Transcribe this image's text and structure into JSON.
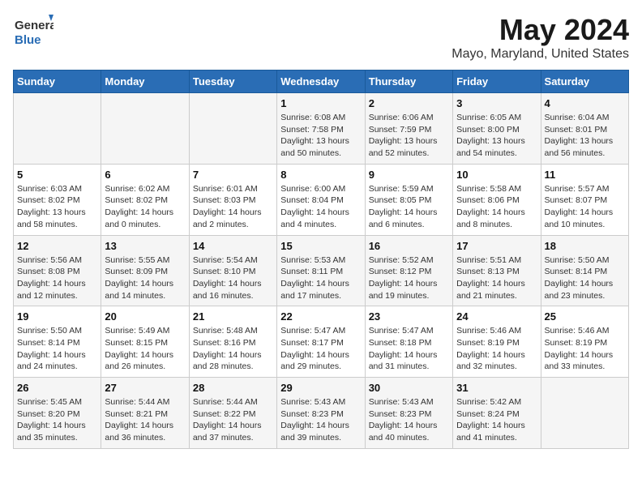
{
  "logo": {
    "text_general": "General",
    "text_blue": "Blue"
  },
  "title": "May 2024",
  "subtitle": "Mayo, Maryland, United States",
  "days_of_week": [
    "Sunday",
    "Monday",
    "Tuesday",
    "Wednesday",
    "Thursday",
    "Friday",
    "Saturday"
  ],
  "weeks": [
    [
      {
        "day": "",
        "sunrise": "",
        "sunset": "",
        "daylight": ""
      },
      {
        "day": "",
        "sunrise": "",
        "sunset": "",
        "daylight": ""
      },
      {
        "day": "",
        "sunrise": "",
        "sunset": "",
        "daylight": ""
      },
      {
        "day": "1",
        "sunrise": "Sunrise: 6:08 AM",
        "sunset": "Sunset: 7:58 PM",
        "daylight": "Daylight: 13 hours and 50 minutes."
      },
      {
        "day": "2",
        "sunrise": "Sunrise: 6:06 AM",
        "sunset": "Sunset: 7:59 PM",
        "daylight": "Daylight: 13 hours and 52 minutes."
      },
      {
        "day": "3",
        "sunrise": "Sunrise: 6:05 AM",
        "sunset": "Sunset: 8:00 PM",
        "daylight": "Daylight: 13 hours and 54 minutes."
      },
      {
        "day": "4",
        "sunrise": "Sunrise: 6:04 AM",
        "sunset": "Sunset: 8:01 PM",
        "daylight": "Daylight: 13 hours and 56 minutes."
      }
    ],
    [
      {
        "day": "5",
        "sunrise": "Sunrise: 6:03 AM",
        "sunset": "Sunset: 8:02 PM",
        "daylight": "Daylight: 13 hours and 58 minutes."
      },
      {
        "day": "6",
        "sunrise": "Sunrise: 6:02 AM",
        "sunset": "Sunset: 8:02 PM",
        "daylight": "Daylight: 14 hours and 0 minutes."
      },
      {
        "day": "7",
        "sunrise": "Sunrise: 6:01 AM",
        "sunset": "Sunset: 8:03 PM",
        "daylight": "Daylight: 14 hours and 2 minutes."
      },
      {
        "day": "8",
        "sunrise": "Sunrise: 6:00 AM",
        "sunset": "Sunset: 8:04 PM",
        "daylight": "Daylight: 14 hours and 4 minutes."
      },
      {
        "day": "9",
        "sunrise": "Sunrise: 5:59 AM",
        "sunset": "Sunset: 8:05 PM",
        "daylight": "Daylight: 14 hours and 6 minutes."
      },
      {
        "day": "10",
        "sunrise": "Sunrise: 5:58 AM",
        "sunset": "Sunset: 8:06 PM",
        "daylight": "Daylight: 14 hours and 8 minutes."
      },
      {
        "day": "11",
        "sunrise": "Sunrise: 5:57 AM",
        "sunset": "Sunset: 8:07 PM",
        "daylight": "Daylight: 14 hours and 10 minutes."
      }
    ],
    [
      {
        "day": "12",
        "sunrise": "Sunrise: 5:56 AM",
        "sunset": "Sunset: 8:08 PM",
        "daylight": "Daylight: 14 hours and 12 minutes."
      },
      {
        "day": "13",
        "sunrise": "Sunrise: 5:55 AM",
        "sunset": "Sunset: 8:09 PM",
        "daylight": "Daylight: 14 hours and 14 minutes."
      },
      {
        "day": "14",
        "sunrise": "Sunrise: 5:54 AM",
        "sunset": "Sunset: 8:10 PM",
        "daylight": "Daylight: 14 hours and 16 minutes."
      },
      {
        "day": "15",
        "sunrise": "Sunrise: 5:53 AM",
        "sunset": "Sunset: 8:11 PM",
        "daylight": "Daylight: 14 hours and 17 minutes."
      },
      {
        "day": "16",
        "sunrise": "Sunrise: 5:52 AM",
        "sunset": "Sunset: 8:12 PM",
        "daylight": "Daylight: 14 hours and 19 minutes."
      },
      {
        "day": "17",
        "sunrise": "Sunrise: 5:51 AM",
        "sunset": "Sunset: 8:13 PM",
        "daylight": "Daylight: 14 hours and 21 minutes."
      },
      {
        "day": "18",
        "sunrise": "Sunrise: 5:50 AM",
        "sunset": "Sunset: 8:14 PM",
        "daylight": "Daylight: 14 hours and 23 minutes."
      }
    ],
    [
      {
        "day": "19",
        "sunrise": "Sunrise: 5:50 AM",
        "sunset": "Sunset: 8:14 PM",
        "daylight": "Daylight: 14 hours and 24 minutes."
      },
      {
        "day": "20",
        "sunrise": "Sunrise: 5:49 AM",
        "sunset": "Sunset: 8:15 PM",
        "daylight": "Daylight: 14 hours and 26 minutes."
      },
      {
        "day": "21",
        "sunrise": "Sunrise: 5:48 AM",
        "sunset": "Sunset: 8:16 PM",
        "daylight": "Daylight: 14 hours and 28 minutes."
      },
      {
        "day": "22",
        "sunrise": "Sunrise: 5:47 AM",
        "sunset": "Sunset: 8:17 PM",
        "daylight": "Daylight: 14 hours and 29 minutes."
      },
      {
        "day": "23",
        "sunrise": "Sunrise: 5:47 AM",
        "sunset": "Sunset: 8:18 PM",
        "daylight": "Daylight: 14 hours and 31 minutes."
      },
      {
        "day": "24",
        "sunrise": "Sunrise: 5:46 AM",
        "sunset": "Sunset: 8:19 PM",
        "daylight": "Daylight: 14 hours and 32 minutes."
      },
      {
        "day": "25",
        "sunrise": "Sunrise: 5:46 AM",
        "sunset": "Sunset: 8:19 PM",
        "daylight": "Daylight: 14 hours and 33 minutes."
      }
    ],
    [
      {
        "day": "26",
        "sunrise": "Sunrise: 5:45 AM",
        "sunset": "Sunset: 8:20 PM",
        "daylight": "Daylight: 14 hours and 35 minutes."
      },
      {
        "day": "27",
        "sunrise": "Sunrise: 5:44 AM",
        "sunset": "Sunset: 8:21 PM",
        "daylight": "Daylight: 14 hours and 36 minutes."
      },
      {
        "day": "28",
        "sunrise": "Sunrise: 5:44 AM",
        "sunset": "Sunset: 8:22 PM",
        "daylight": "Daylight: 14 hours and 37 minutes."
      },
      {
        "day": "29",
        "sunrise": "Sunrise: 5:43 AM",
        "sunset": "Sunset: 8:23 PM",
        "daylight": "Daylight: 14 hours and 39 minutes."
      },
      {
        "day": "30",
        "sunrise": "Sunrise: 5:43 AM",
        "sunset": "Sunset: 8:23 PM",
        "daylight": "Daylight: 14 hours and 40 minutes."
      },
      {
        "day": "31",
        "sunrise": "Sunrise: 5:42 AM",
        "sunset": "Sunset: 8:24 PM",
        "daylight": "Daylight: 14 hours and 41 minutes."
      },
      {
        "day": "",
        "sunrise": "",
        "sunset": "",
        "daylight": ""
      }
    ]
  ]
}
